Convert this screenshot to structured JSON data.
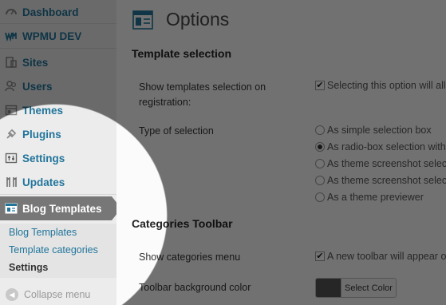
{
  "sidebar": {
    "items": [
      {
        "label": "Dashboard",
        "icon": "dashboard-icon"
      },
      {
        "label": "WPMU DEV",
        "icon": "wpmudev-icon"
      },
      {
        "label": "Sites",
        "icon": "sites-icon"
      },
      {
        "label": "Users",
        "icon": "users-icon"
      },
      {
        "label": "Themes",
        "icon": "themes-icon"
      },
      {
        "label": "Plugins",
        "icon": "plugins-icon"
      },
      {
        "label": "Settings",
        "icon": "settings-icon"
      },
      {
        "label": "Updates",
        "icon": "updates-icon"
      },
      {
        "label": "Blog Templates",
        "icon": "blog-templates-icon",
        "active": true
      }
    ],
    "submenu": [
      "Blog Templates",
      "Template categories",
      "Settings"
    ],
    "current_submenu": "Settings",
    "collapse_label": "Collapse menu"
  },
  "main": {
    "title": "Options",
    "template_selection": {
      "heading": "Template selection",
      "show_label": "Show templates selection on registration:",
      "show_checkbox_text": "Selecting this option will all",
      "type_label": "Type of selection",
      "options": [
        {
          "label": "As simple selection box",
          "checked": false
        },
        {
          "label": "As radio-box selection with",
          "checked": true
        },
        {
          "label": "As theme screenshot selec",
          "checked": false
        },
        {
          "label": "As theme screenshot selec",
          "checked": false
        },
        {
          "label": "As a theme previewer",
          "checked": false
        }
      ]
    },
    "categories_toolbar": {
      "heading": "Categories Toolbar",
      "show_menu_label": "Show categories menu",
      "show_menu_text": "A new toolbar will appear o",
      "bg_color_label": "Toolbar background color",
      "select_color_label": "Select Color",
      "swatch_color": "#555555"
    }
  },
  "colors": {
    "link": "#21759b",
    "active_menu_bg": "#777777"
  }
}
